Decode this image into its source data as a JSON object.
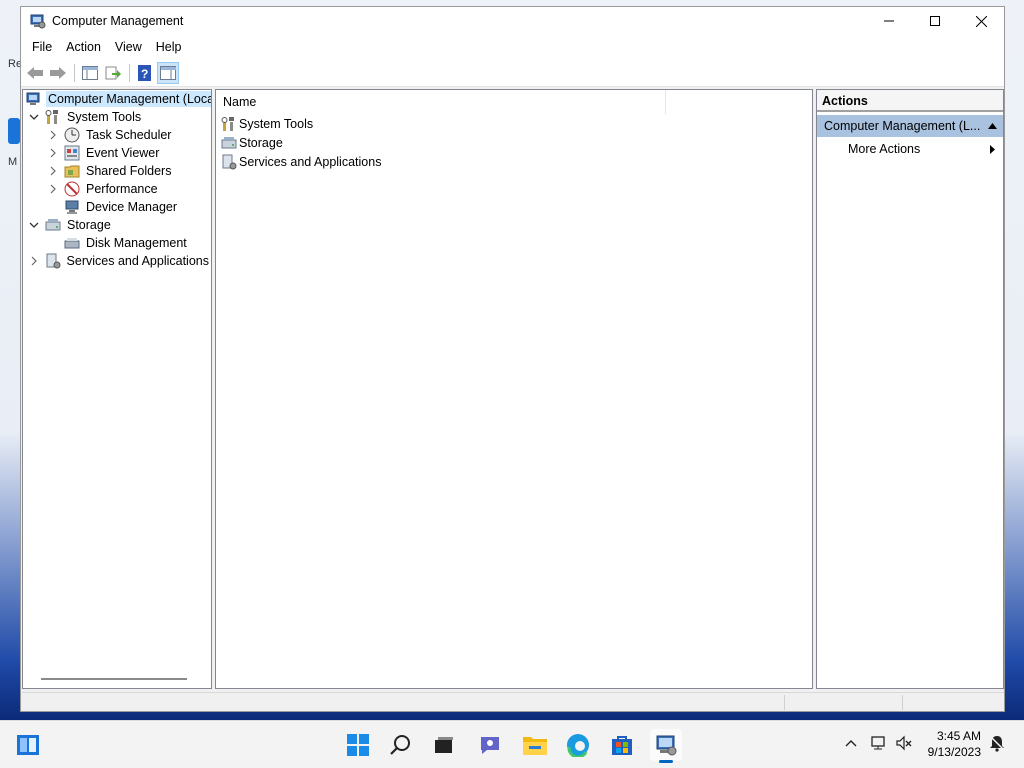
{
  "window": {
    "title": "Computer Management",
    "icon": "computer-management-icon"
  },
  "menubar": [
    "File",
    "Action",
    "View",
    "Help"
  ],
  "toolbar": [
    "back-arrow-icon",
    "forward-arrow-icon",
    "show-hide-console-tree-icon",
    "export-list-icon",
    "help-icon",
    "show-hide-action-pane-icon"
  ],
  "tree": {
    "root": "Computer Management (Local",
    "system_tools": "System Tools",
    "task_scheduler": "Task Scheduler",
    "event_viewer": "Event Viewer",
    "shared_folders": "Shared Folders",
    "performance": "Performance",
    "device_manager": "Device Manager",
    "storage": "Storage",
    "disk_management": "Disk Management",
    "services_apps": "Services and Applications"
  },
  "list": {
    "column_name": "Name",
    "items": [
      "System Tools",
      "Storage",
      "Services and Applications"
    ]
  },
  "actions": {
    "header": "Actions",
    "section": "Computer Management (L...",
    "more_actions": "More Actions"
  },
  "desktop": {
    "label_a": "Re",
    "label_c": "M"
  },
  "taskbar": {
    "time": "3:45 AM",
    "date": "9/13/2023"
  },
  "colors": {
    "selection": "#cce8ff",
    "actions_section": "#a9c2df",
    "accent": "#0067c0"
  }
}
